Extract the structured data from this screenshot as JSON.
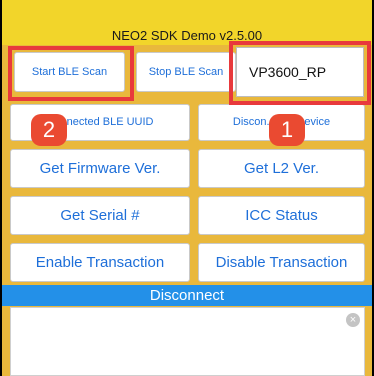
{
  "app": {
    "title": "NEO2 SDK Demo v2.5.00"
  },
  "buttons": {
    "start_ble_scan": "Start BLE Scan",
    "stop_ble_scan": "Stop BLE Scan",
    "connected_ble_uuid": "Connected BLE UUID",
    "disconnect_ble_device": "Discon. BLE Device",
    "get_firmware_ver": "Get Firmware Ver.",
    "get_l2_ver": "Get L2 Ver.",
    "get_serial": "Get Serial #",
    "icc_status": "ICC Status",
    "enable_transaction": "Enable Transaction",
    "disable_transaction": "Disable Transaction",
    "disconnect": "Disconnect"
  },
  "device_field": {
    "value": "VP3600_RP"
  },
  "annotations": {
    "badge_1": "1",
    "badge_2": "2"
  },
  "log": {
    "clear_icon": "close-circle-icon",
    "clear_glyph": "×"
  },
  "colors": {
    "title_bar": "#f2d52a",
    "background": "#e9b83c",
    "button_text": "#1e6fd9",
    "highlight": "#e8393c",
    "badge": "#ea4a31",
    "disconnect_bar": "#2390e8"
  }
}
